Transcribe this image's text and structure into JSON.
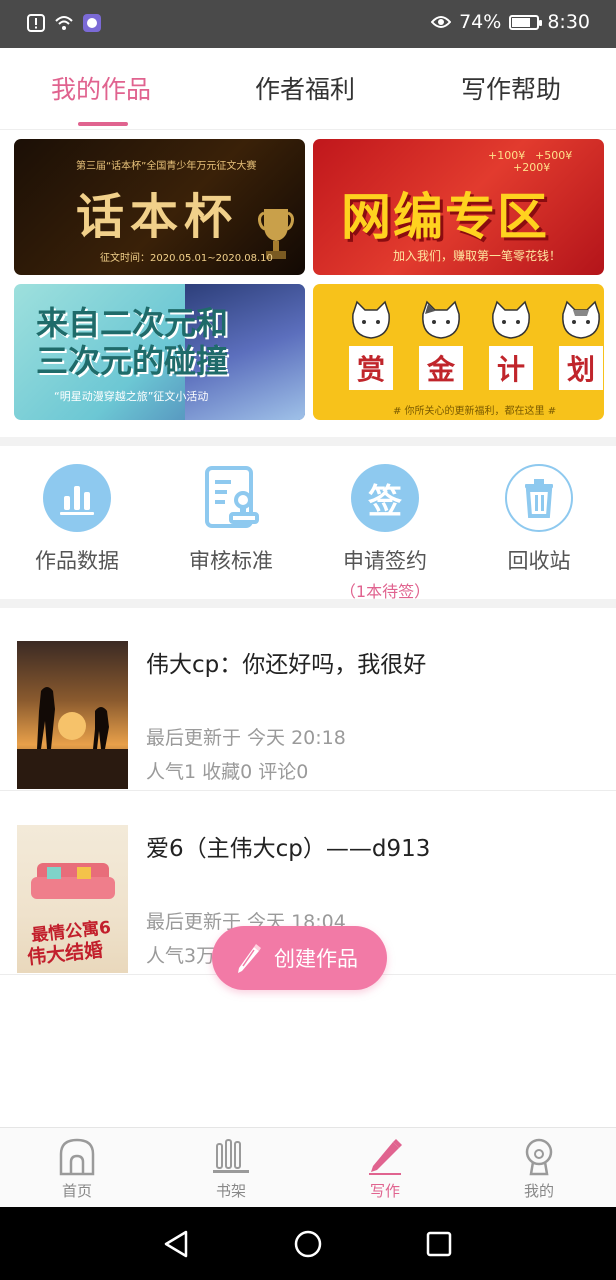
{
  "status": {
    "battery": "74%",
    "battery_level": 0.74,
    "time": "8:30"
  },
  "tabs": [
    {
      "label": "我的作品",
      "active": true
    },
    {
      "label": "作者福利",
      "active": false
    },
    {
      "label": "写作帮助",
      "active": false
    }
  ],
  "banners": [
    {
      "top_text": "第三届“话本杯”全国青少年万元征文大赛",
      "title": "话本杯",
      "sub": "征文时间：2020.05.01~2020.08.10"
    },
    {
      "title": "网编专区",
      "tags": [
        "+100¥",
        "+500¥",
        "+200¥"
      ],
      "sub": "加入我们，赚取第一笔零花钱！"
    },
    {
      "title_line1": "来自二次元和",
      "title_line2": "三次元的碰撞",
      "sub": "“明星动漫穿越之旅”征文小活动"
    },
    {
      "chars": [
        "赏",
        "金",
        "计",
        "划"
      ],
      "sub": "# 你所关心的更新福利，都在这里 #"
    }
  ],
  "quick_actions": [
    {
      "label": "作品数据",
      "icon": "bar-chart-icon"
    },
    {
      "label": "审核标准",
      "icon": "document-stamp-icon"
    },
    {
      "label": "申请签约",
      "icon": "sign-icon",
      "glyph": "签",
      "sub": "（1本待签）"
    },
    {
      "label": "回收站",
      "icon": "trash-icon"
    }
  ],
  "works": [
    {
      "title": "伟大cp：你还好吗，我很好",
      "updated": "最后更新于 今天 20:18",
      "stats": "人气1  收藏0  评论0"
    },
    {
      "title": "爱6（主伟大cp）——d913",
      "updated": "最后更新于 今天 18:04",
      "stats": "人气3万  收藏3  评论3",
      "cover_text_1": "最情公寓6",
      "cover_text_2": "伟大结婚"
    }
  ],
  "fab": {
    "label": "创建作品"
  },
  "bottom_nav": [
    {
      "label": "首页",
      "icon": "home-icon",
      "active": false
    },
    {
      "label": "书架",
      "icon": "bookshelf-icon",
      "active": false
    },
    {
      "label": "写作",
      "icon": "pen-icon",
      "active": true
    },
    {
      "label": "我的",
      "icon": "profile-icon",
      "active": false
    }
  ],
  "colors": {
    "accent": "#e0638f",
    "fab": "#f27aa6",
    "action_blue": "#8ec9ef"
  }
}
